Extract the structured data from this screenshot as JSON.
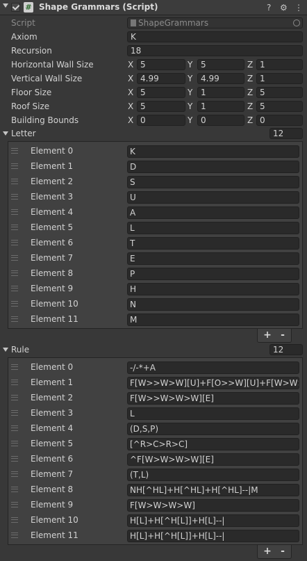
{
  "header": {
    "title": "Shape Grammars (Script)",
    "icon_script": "#",
    "icon_help": "?",
    "icon_settings": "⚙",
    "icon_more": "⋮"
  },
  "fields": {
    "script": {
      "label": "Script",
      "value": "ShapeGrammars"
    },
    "axiom": {
      "label": "Axiom",
      "value": "K"
    },
    "recursion": {
      "label": "Recursion",
      "value": "18"
    },
    "horizontal_wall_size": {
      "label": "Horizontal Wall Size",
      "x": "5",
      "y": "5",
      "z": "1"
    },
    "vertical_wall_size": {
      "label": "Vertical Wall Size",
      "x": "4.99",
      "y": "4.99",
      "z": "1"
    },
    "floor_size": {
      "label": "Floor Size",
      "x": "5",
      "y": "1",
      "z": "5"
    },
    "roof_size": {
      "label": "Roof Size",
      "x": "5",
      "y": "1",
      "z": "5"
    },
    "building_bounds": {
      "label": "Building Bounds",
      "x": "0",
      "y": "0",
      "z": "0"
    }
  },
  "axes": {
    "x": "X",
    "y": "Y",
    "z": "Z"
  },
  "letter": {
    "label": "Letter",
    "count": "12",
    "elements": [
      {
        "label": "Element 0",
        "value": "K"
      },
      {
        "label": "Element 1",
        "value": "D"
      },
      {
        "label": "Element 2",
        "value": "S"
      },
      {
        "label": "Element 3",
        "value": "U"
      },
      {
        "label": "Element 4",
        "value": "A"
      },
      {
        "label": "Element 5",
        "value": "L"
      },
      {
        "label": "Element 6",
        "value": "T"
      },
      {
        "label": "Element 7",
        "value": "E"
      },
      {
        "label": "Element 8",
        "value": "P"
      },
      {
        "label": "Element 9",
        "value": "H"
      },
      {
        "label": "Element 10",
        "value": "N"
      },
      {
        "label": "Element 11",
        "value": "M"
      }
    ]
  },
  "rule": {
    "label": "Rule",
    "count": "12",
    "elements": [
      {
        "label": "Element 0",
        "value": "-/-*+A"
      },
      {
        "label": "Element 1",
        "value": "F[W>>W>W][U]+F[O>>W][U]+F[W>W>W]"
      },
      {
        "label": "Element 2",
        "value": "F[W>>W>W>W][E]"
      },
      {
        "label": "Element 3",
        "value": "L"
      },
      {
        "label": "Element 4",
        "value": "(D,S,P)"
      },
      {
        "label": "Element 5",
        "value": "[^R>C>R>C]"
      },
      {
        "label": "Element 6",
        "value": "^F[W>W>W>W][E]"
      },
      {
        "label": "Element 7",
        "value": "(T,L)"
      },
      {
        "label": "Element 8",
        "value": "NH[^HL]+H[^HL]+H[^HL]--|M"
      },
      {
        "label": "Element 9",
        "value": "F[W>W>W>W]"
      },
      {
        "label": "Element 10",
        "value": "H[L]+H[^H[L]]+H[L]--|"
      },
      {
        "label": "Element 11",
        "value": "H[L]+H[^H[L]]+H[L]--|"
      }
    ]
  },
  "buttons": {
    "add": "+",
    "remove": "-"
  }
}
